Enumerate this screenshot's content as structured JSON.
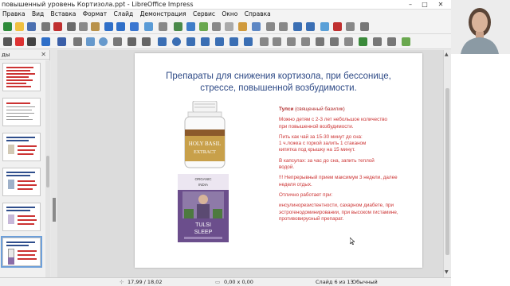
{
  "window": {
    "title": "повышенный уровень Кортизола.ppt - LibreOffice Impress",
    "min_label": "–",
    "max_label": "□",
    "close_label": "✕"
  },
  "menu": [
    "Правка",
    "Вид",
    "Вставка",
    "Формат",
    "Слайд",
    "Демонстрация",
    "Сервис",
    "Окно",
    "Справка"
  ],
  "sidebar": {
    "header": "ды",
    "close_label": "✕"
  },
  "slide": {
    "title_line1": "Препараты для снижения кортизола, при бессонице,",
    "title_line2": "стрессе, повышенной возбудимости.",
    "heading_bold": "Тулси",
    "heading_rest": " (священный базилик)",
    "p1_l1": "Можно детям с 2-3 лет небольшое количество",
    "p1_l2": "при повышенной возбудимости.",
    "p2_l1": "Пить как чай за 15-30 минут до сна:",
    "p2_l2": "1 ч.ложка с горкой залить 1 стаканом",
    "p2_l3": "кипятка под крышку на 15 минут.",
    "p3_l1": "В капсулах: за час до сна, запить теплой",
    "p3_l2": "водой.",
    "p4_l1": "!!! Непрерывный прием максимум 3 недели, далее",
    "p4_l2": "неделя отдых.",
    "p5": "Отлично работает при:",
    "p6_l1": "инсулинорезистентности, сахарном диабете, при",
    "p6_l2": "эстрогенодоминировании, при высоком гистамине,",
    "p6_l3": "противовирусный препарат.",
    "bottle_label_1": "HOLY BASIL",
    "bottle_label_2": "EXTRACT",
    "tea_brand_1": "ORGANIC",
    "tea_brand_2": "INDIA",
    "tea_name_1": "TULSI",
    "tea_name_2": "SLEEP"
  },
  "status": {
    "position": "17,99 / 18,02",
    "size": "0,00 x 0,00",
    "slide": "Слайд 6 из 13",
    "layout": "Обычный"
  },
  "colors": {
    "title": "#2e4a86",
    "body_text": "#cc3333",
    "accent_selection": "#6d9fd9"
  }
}
